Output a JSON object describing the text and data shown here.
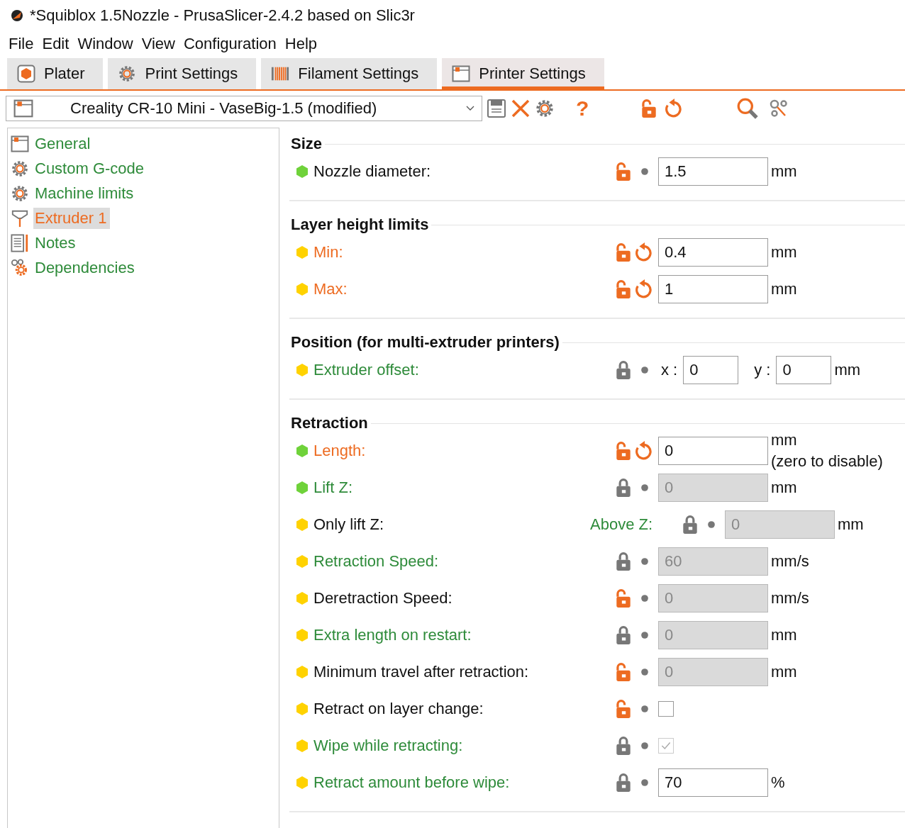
{
  "window": {
    "title": "*Squiblox 1.5Nozzle - PrusaSlicer-2.4.2 based on Slic3r"
  },
  "menu": [
    "File",
    "Edit",
    "Window",
    "View",
    "Configuration",
    "Help"
  ],
  "tabs": [
    {
      "label": "Plater",
      "kind": "plater",
      "selected": false
    },
    {
      "label": "Print Settings",
      "kind": "print",
      "selected": false
    },
    {
      "label": "Filament Settings",
      "kind": "filament",
      "selected": false
    },
    {
      "label": "Printer Settings",
      "kind": "printer",
      "selected": true
    }
  ],
  "preset": {
    "value": "Creality CR-10 Mini - VaseBig-1.5 (modified)"
  },
  "toolbar": [
    {
      "kind": "save"
    },
    {
      "kind": "delete"
    },
    {
      "kind": "gear"
    },
    {
      "kind": "help",
      "glyph": "?"
    },
    {
      "kind": "unlock"
    },
    {
      "kind": "undo"
    },
    {
      "kind": "search"
    },
    {
      "kind": "search-settings"
    }
  ],
  "sidebar": {
    "items": [
      {
        "label": "General",
        "kind": "printer",
        "modified": false,
        "selected": false
      },
      {
        "label": "Custom G-code",
        "kind": "gear",
        "modified": false,
        "selected": false
      },
      {
        "label": "Machine limits",
        "kind": "gear",
        "modified": false,
        "selected": false
      },
      {
        "label": "Extruder 1",
        "kind": "extruder",
        "modified": true,
        "selected": true
      },
      {
        "label": "Notes",
        "kind": "notes",
        "modified": false,
        "selected": false
      },
      {
        "label": "Dependencies",
        "kind": "dependencies",
        "modified": false,
        "selected": false
      }
    ]
  },
  "sections": [
    {
      "title": "Size",
      "rows": [
        {
          "label": "Nozzle diameter:",
          "advanced": false,
          "system": false,
          "modified": false,
          "locked": false,
          "field": {
            "kind": "text",
            "value": "1.5",
            "disabled": false
          },
          "unit": "mm"
        }
      ]
    },
    {
      "title": "Layer height limits",
      "rows": [
        {
          "label": "Min:",
          "advanced": true,
          "modified": true,
          "locked": false,
          "field": {
            "kind": "text",
            "value": "0.4",
            "disabled": false
          },
          "unit": "mm"
        },
        {
          "label": "Max:",
          "advanced": true,
          "modified": true,
          "locked": false,
          "field": {
            "kind": "text",
            "value": "1",
            "disabled": false
          },
          "unit": "mm"
        }
      ]
    },
    {
      "title": "Position (for multi-extruder printers)",
      "rows": [
        {
          "label": "Extruder offset:",
          "advanced": true,
          "system": true,
          "modified": false,
          "locked": true,
          "field": {
            "kind": "xy",
            "parts": [
              {
                "prefix": "x :",
                "value": "0"
              },
              {
                "prefix": "y :",
                "value": "0"
              }
            ]
          },
          "unit": "mm"
        }
      ]
    },
    {
      "title": "Retraction",
      "rows": [
        {
          "label": "Length:",
          "advanced": false,
          "modified": true,
          "locked": false,
          "field": {
            "kind": "text",
            "value": "0",
            "disabled": false
          },
          "unit": "mm",
          "note": "(zero to disable)"
        },
        {
          "label": "Lift Z:",
          "advanced": false,
          "system": true,
          "modified": false,
          "locked": true,
          "field": {
            "kind": "text",
            "value": "0",
            "disabled": true
          },
          "unit": "mm"
        },
        {
          "label": "Only lift Z:",
          "advanced": true,
          "system": false,
          "modified": false,
          "sublabel": {
            "label": "Above Z:",
            "system": true
          },
          "locked": true,
          "field": {
            "kind": "text",
            "value": "0",
            "disabled": true
          },
          "unit": "mm"
        },
        {
          "label": "Retraction Speed:",
          "advanced": true,
          "system": true,
          "modified": false,
          "locked": true,
          "field": {
            "kind": "text",
            "value": "60",
            "disabled": true
          },
          "unit": "mm/s"
        },
        {
          "label": "Deretraction Speed:",
          "advanced": true,
          "system": false,
          "modified": false,
          "locked": false,
          "field": {
            "kind": "text",
            "value": "0",
            "disabled": true
          },
          "unit": "mm/s"
        },
        {
          "label": "Extra length on restart:",
          "advanced": true,
          "system": true,
          "modified": false,
          "locked": true,
          "field": {
            "kind": "text",
            "value": "0",
            "disabled": true
          },
          "unit": "mm"
        },
        {
          "label": "Minimum travel after retraction:",
          "advanced": true,
          "system": false,
          "modified": false,
          "locked": false,
          "field": {
            "kind": "text",
            "value": "0",
            "disabled": true
          },
          "unit": "mm"
        },
        {
          "label": "Retract on layer change:",
          "advanced": true,
          "system": false,
          "modified": false,
          "locked": false,
          "field": {
            "kind": "checkbox",
            "checked": false,
            "disabled": false
          }
        },
        {
          "label": "Wipe while retracting:",
          "advanced": true,
          "system": true,
          "modified": false,
          "locked": true,
          "field": {
            "kind": "checkbox",
            "checked": true,
            "disabled": true
          }
        },
        {
          "label": "Retract amount before wipe:",
          "advanced": true,
          "system": true,
          "modified": false,
          "locked": true,
          "field": {
            "kind": "text",
            "value": "70",
            "disabled": false
          },
          "unit": "%"
        }
      ]
    }
  ]
}
